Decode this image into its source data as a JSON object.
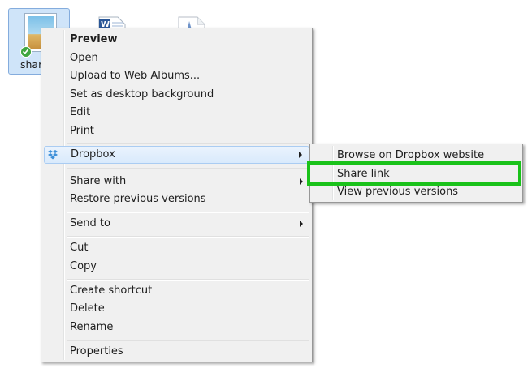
{
  "files": {
    "selected_label": "shar"
  },
  "context_menu": {
    "items": [
      {
        "label": "Preview"
      },
      {
        "label": "Open"
      },
      {
        "label": "Upload to Web Albums..."
      },
      {
        "label": "Set as desktop background"
      },
      {
        "label": "Edit"
      },
      {
        "label": "Print"
      },
      {
        "label": "Dropbox"
      },
      {
        "label": "Share with"
      },
      {
        "label": "Restore previous versions"
      },
      {
        "label": "Send to"
      },
      {
        "label": "Cut"
      },
      {
        "label": "Copy"
      },
      {
        "label": "Create shortcut"
      },
      {
        "label": "Delete"
      },
      {
        "label": "Rename"
      },
      {
        "label": "Properties"
      }
    ]
  },
  "dropbox_submenu": {
    "items": [
      {
        "label": "Browse on Dropbox website"
      },
      {
        "label": "Share link"
      },
      {
        "label": "View previous versions"
      }
    ]
  },
  "colors": {
    "highlight_box": "#1ac21a",
    "menu_background": "#f0f0f0",
    "selection": "#cfe4f9"
  }
}
